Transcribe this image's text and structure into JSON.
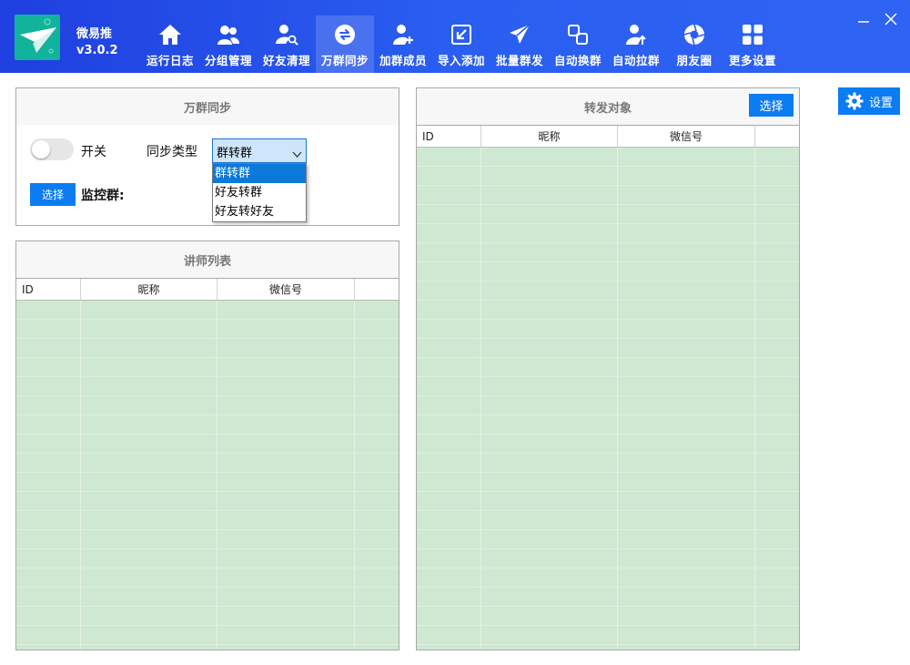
{
  "app": {
    "name": "微易推",
    "version": "v3.0.2"
  },
  "nav": [
    {
      "label": "运行日志",
      "icon": "home-icon",
      "active": false
    },
    {
      "label": "分组管理",
      "icon": "users-icon",
      "active": false
    },
    {
      "label": "好友清理",
      "icon": "user-search-icon",
      "active": false
    },
    {
      "label": "万群同步",
      "icon": "sync-icon",
      "active": true
    },
    {
      "label": "加群成员",
      "icon": "user-add-icon",
      "active": false
    },
    {
      "label": "导入添加",
      "icon": "import-icon",
      "active": false
    },
    {
      "label": "批量群发",
      "icon": "send-icon",
      "active": false
    },
    {
      "label": "自动换群",
      "icon": "swap-icon",
      "active": false
    },
    {
      "label": "自动拉群",
      "icon": "user-up-icon",
      "active": false
    },
    {
      "label": "朋友圈",
      "icon": "aperture-icon",
      "active": false
    },
    {
      "label": "更多设置",
      "icon": "grid-icon",
      "active": false
    }
  ],
  "sync_panel": {
    "title": "万群同步",
    "switch_label": "开关",
    "switch_on": false,
    "sync_type_label": "同步类型",
    "sync_type_value": "群转群",
    "sync_type_options": [
      "群转群",
      "好友转群",
      "好友转好友"
    ],
    "select_button": "选择",
    "monitor_label": "监控群:"
  },
  "lecturer_panel": {
    "title": "讲师列表",
    "columns": [
      "ID",
      "昵称",
      "微信号",
      ""
    ]
  },
  "forward_panel": {
    "title": "转发对象",
    "select_button": "选择",
    "columns": [
      "ID",
      "昵称",
      "微信号",
      ""
    ]
  },
  "settings_button": "设置",
  "colors": {
    "header": "#2a5ef0",
    "accent": "#0c7cf2",
    "row_fill": "#cfe8d2",
    "logo": "#11b39a"
  }
}
